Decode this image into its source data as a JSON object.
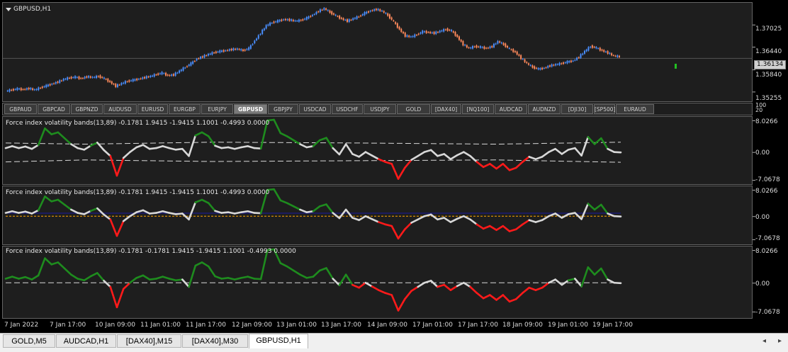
{
  "chart_title": "GBPUSD,H1",
  "price_axis": [
    "1.37025",
    "1.36440",
    "1.35840",
    "1.35255"
  ],
  "current_price": "1.36134",
  "symbol_buttons": [
    {
      "label": "GBPAUD",
      "active": false
    },
    {
      "label": "GBPCAD",
      "active": false
    },
    {
      "label": "GBPNZD",
      "active": false
    },
    {
      "label": "AUDUSD",
      "active": false
    },
    {
      "label": "EURUSD",
      "active": false
    },
    {
      "label": "EURGBP",
      "active": false
    },
    {
      "label": "EURJPY",
      "active": false
    },
    {
      "label": "GBPUSD",
      "active": true
    },
    {
      "label": "GBPJPY",
      "active": false
    },
    {
      "label": "USDCAD",
      "active": false
    },
    {
      "label": "USDCHF",
      "active": false
    },
    {
      "label": "USDJPY",
      "active": false
    },
    {
      "label": "GOLD",
      "active": false
    },
    {
      "label": "[DAX40]",
      "active": false
    },
    {
      "label": "[NQ100]",
      "active": false
    },
    {
      "label": "AUDCAD",
      "active": false
    },
    {
      "label": "AUDNZD",
      "active": false
    },
    {
      "label": "[DJI30]",
      "active": false
    },
    {
      "label": "[SP500]",
      "active": false
    },
    {
      "label": "EURAUD",
      "active": false
    }
  ],
  "symbar_axis": [
    "100",
    "20"
  ],
  "indicators": [
    {
      "title": "Force index volatility bands(13,89) -0.1781 1.9415 -1.9415 1.1001 -0.4993 0.0000",
      "axis": [
        "8.0266",
        "0.00",
        "-7.0678"
      ]
    },
    {
      "title": "Force index volatility bands(13,89) -0.1781 1.9415 -1.9415 1.1001 -0.4993 0.0000",
      "axis": [
        "8.0266",
        "0.00",
        "-7.0678"
      ]
    },
    {
      "title": "Force index volatility bands(13,89) -0.1781 -0.1781 1.9415 -1.9415 1.1001 -0.4993 0.0000",
      "axis": [
        "8.0266",
        "0.00",
        "-7.0678"
      ]
    }
  ],
  "time_axis": [
    "7 Jan 2022",
    "7 Jan 17:00",
    "10 Jan 09:00",
    "11 Jan 01:00",
    "11 Jan 17:00",
    "12 Jan 09:00",
    "13 Jan 01:00",
    "13 Jan 17:00",
    "14 Jan 09:00",
    "17 Jan 01:00",
    "17 Jan 17:00",
    "18 Jan 09:00",
    "19 Jan 01:00",
    "19 Jan 17:00"
  ],
  "tabs": [
    {
      "label": "GOLD,M5",
      "active": false
    },
    {
      "label": "AUDCAD,H1",
      "active": false
    },
    {
      "label": "[DAX40],M15",
      "active": false
    },
    {
      "label": "[DAX40],M30",
      "active": false
    },
    {
      "label": "GBPUSD,H1",
      "active": true
    }
  ],
  "colors": {
    "bull": "#4a8fff",
    "bear": "#ff8a5c",
    "pos": "#1e8c1e",
    "neg": "#ff1a1a",
    "neutral": "#d8d8d8",
    "band": "#d8d8d8",
    "level": "#1a1aa0",
    "signal": "#ffa500"
  },
  "price_series": [
    1.3527,
    1.353,
    1.3533,
    1.3531,
    1.3534,
    1.353,
    1.3536,
    1.3541,
    1.3546,
    1.3551,
    1.3558,
    1.3562,
    1.3564,
    1.356,
    1.3565,
    1.3563,
    1.3566,
    1.356,
    1.3551,
    1.354,
    1.3547,
    1.3553,
    1.3556,
    1.3559,
    1.3563,
    1.3566,
    1.3571,
    1.3575,
    1.3568,
    1.357,
    1.358,
    1.359,
    1.36,
    1.3612,
    1.3618,
    1.3624,
    1.3629,
    1.3632,
    1.3634,
    1.3637,
    1.3638,
    1.3634,
    1.364,
    1.366,
    1.368,
    1.37,
    1.3708,
    1.3712,
    1.3716,
    1.3715,
    1.3712,
    1.3714,
    1.372,
    1.3728,
    1.3738,
    1.3745,
    1.3735,
    1.3726,
    1.3718,
    1.3712,
    1.3718,
    1.3724,
    1.3733,
    1.3739,
    1.3743,
    1.3738,
    1.3727,
    1.371,
    1.369,
    1.3673,
    1.367,
    1.3676,
    1.3684,
    1.3682,
    1.368,
    1.3685,
    1.369,
    1.3686,
    1.367,
    1.365,
    1.364,
    1.3645,
    1.3643,
    1.364,
    1.3645,
    1.3658,
    1.365,
    1.3638,
    1.363,
    1.3614,
    1.36,
    1.359,
    1.3585,
    1.3588,
    1.3594,
    1.3597,
    1.36,
    1.3604,
    1.3607,
    1.3617,
    1.3632,
    1.3645,
    1.3641,
    1.3634,
    1.3628,
    1.362,
    1.3618
  ],
  "force_series": [
    1.0,
    1.5,
    1.0,
    1.4,
    0.8,
    1.8,
    6.0,
    4.5,
    5.0,
    3.5,
    2.0,
    1.0,
    0.6,
    1.6,
    2.4,
    0.5,
    -1.0,
    -6.0,
    -1.5,
    0.0,
    1.2,
    1.8,
    0.8,
    1.0,
    1.5,
    1.0,
    0.6,
    0.8,
    -1.0,
    4.2,
    5.0,
    4.0,
    1.6,
    1.0,
    1.2,
    0.8,
    1.2,
    1.5,
    1.0,
    0.9,
    8.0,
    8.2,
    4.8,
    4.0,
    3.0,
    2.0,
    1.2,
    1.5,
    3.0,
    3.6,
    1.0,
    -0.6,
    2.0,
    -0.5,
    -1.2,
    0.0,
    -0.9,
    -1.8,
    -2.5,
    -3.0,
    -6.8,
    -4.0,
    -2.0,
    -1.0,
    0.0,
    0.5,
    -1.0,
    -0.5,
    -1.8,
    -0.8,
    0.0,
    -1.0,
    -2.5,
    -3.8,
    -3.0,
    -4.2,
    -3.0,
    -4.6,
    -4.0,
    -2.5,
    -1.2,
    -1.8,
    -1.2,
    0.0,
    0.8,
    -0.5,
    0.6,
    1.0,
    -0.9,
    3.8,
    2.0,
    3.5,
    0.8,
    0.0,
    -0.1
  ]
}
